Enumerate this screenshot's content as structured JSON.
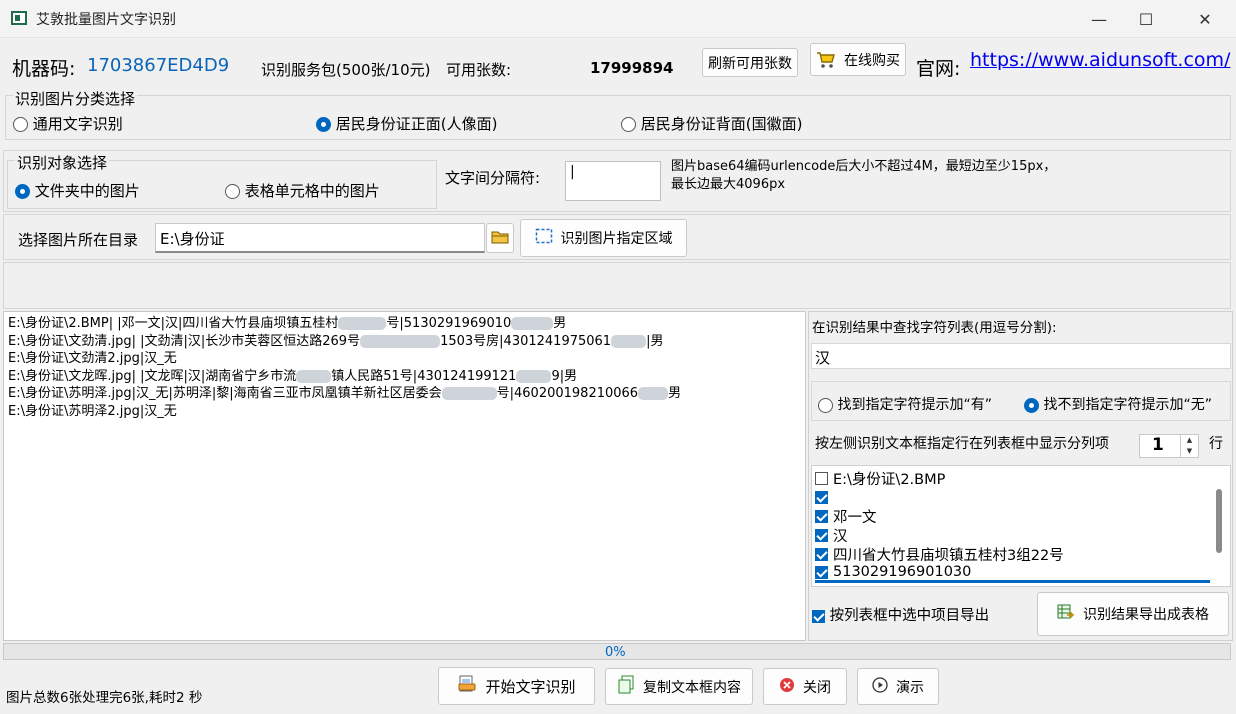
{
  "window": {
    "title": "艾敦批量图片文字识别",
    "minimize": "—",
    "maximize": "☐",
    "close": "✕"
  },
  "header": {
    "machine_code_label": "机器码:",
    "machine_code": "1703867ED4D9",
    "service_package": "识别服务包(500张/10元)",
    "available_label": "可用张数:",
    "available_count": "17999894",
    "refresh_button": "刷新可用张数",
    "buy_button": "在线购买",
    "website_label": "官网:",
    "website_url": "https://www.aidunsoft.com/"
  },
  "category_group": {
    "title": "识别图片分类选择",
    "options": [
      {
        "label": "通用文字识别",
        "selected": false
      },
      {
        "label": "居民身份证正面(人像面)",
        "selected": true
      },
      {
        "label": "居民身份证背面(国徽面)",
        "selected": false
      }
    ]
  },
  "target_group": {
    "title": "识别对象选择",
    "options": [
      {
        "label": "文件夹中的图片",
        "selected": true
      },
      {
        "label": "表格单元格中的图片",
        "selected": false
      }
    ]
  },
  "separator": {
    "label": "文字间分隔符:",
    "value": "|"
  },
  "note": {
    "line1": "图片base64编码urlencode后大小不超过4M，最短边至少15px，",
    "line2": "最长边最大4096px"
  },
  "directory": {
    "label": "选择图片所在目录",
    "value": "E:\\身份证",
    "region_button": "识别图片指定区域"
  },
  "results": [
    {
      "a": "E:\\身份证\\2.BMP| |邓一文|汉|四川省大竹县庙坝镇五桂村",
      "b": "号|5130291969010",
      "c": "男"
    },
    {
      "a": "E:\\身份证\\文劲清.jpg| |文劲清|汉|长沙市芙蓉区恒达路269号",
      "b": "1503号房|4301241975061",
      "c": "|男"
    },
    {
      "a": "E:\\身份证\\文劲清2.jpg|汉_无",
      "b": "",
      "c": ""
    },
    {
      "a": "E:\\身份证\\文龙晖.jpg| |文龙晖|汉|湖南省宁乡市流",
      "b": "镇人民路51号|430124199121",
      "c": "9|男"
    },
    {
      "a": "E:\\身份证\\苏明泽.jpg|汉_无|苏明泽|黎|海南省三亚市凤凰镇羊新社区居委会",
      "b": "号|460200198210066",
      "c": "男"
    },
    {
      "a": "E:\\身份证\\苏明泽2.jpg|汉_无",
      "b": "",
      "c": ""
    }
  ],
  "search": {
    "label": "在识别结果中查找字符列表(用逗号分割):",
    "value": "汉",
    "found_option": "找到指定字符提示加“有”",
    "notfound_option": "找不到指定字符提示加“无”",
    "found_selected": false,
    "notfound_selected": true
  },
  "row_select": {
    "label": "按左侧识别文本框指定行在列表框中显示分列项",
    "value": "1",
    "suffix": "行"
  },
  "columns_list": [
    {
      "label": "E:\\身份证\\2.BMP",
      "checked": false
    },
    {
      "label": "",
      "checked": true
    },
    {
      "label": "邓一文",
      "checked": true
    },
    {
      "label": "汉",
      "checked": true
    },
    {
      "label": "四川省大竹县庙坝镇五桂村3组22号",
      "checked": true
    },
    {
      "label": "513029196901030",
      "checked": true
    }
  ],
  "export": {
    "checkbox_label": "按列表框中选中项目导出",
    "checkbox_checked": true,
    "button": "识别结果导出成表格"
  },
  "progress": {
    "text": "0%",
    "value": 0
  },
  "status": "图片总数6张处理完6张,耗时2 秒",
  "actions": {
    "start": "开始文字识别",
    "copy": "复制文本框内容",
    "close": "关闭",
    "demo": "演示"
  },
  "colors": {
    "accent": "#0067c0",
    "link": "#0000ee",
    "machine_code": "#0a64b8"
  }
}
